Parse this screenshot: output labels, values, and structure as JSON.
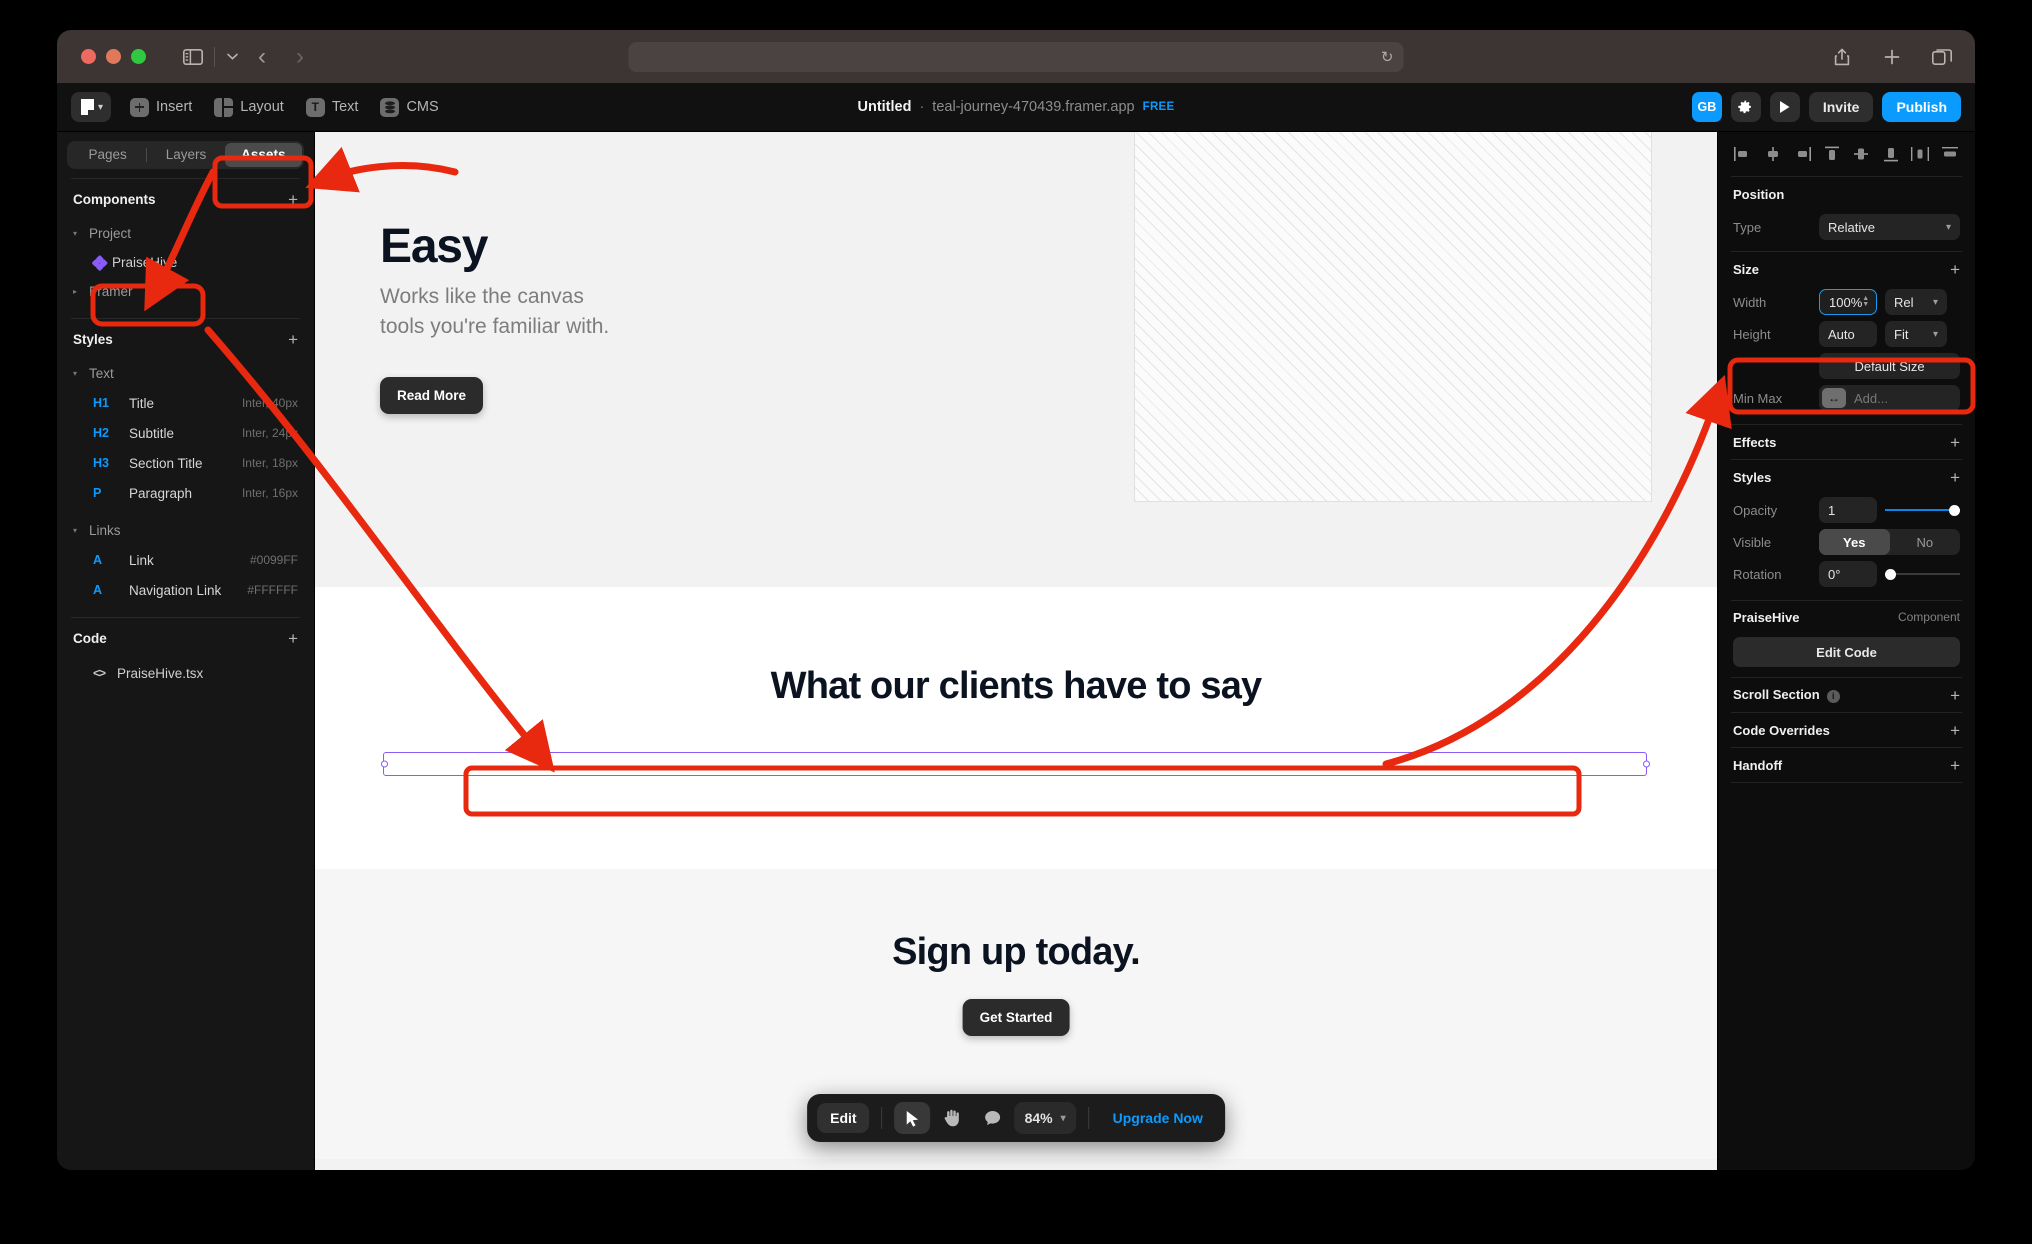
{
  "browser": {
    "traffic_lights": [
      "close",
      "minimize",
      "maximize"
    ],
    "sidebar_icon": "sidebar-toggle-icon",
    "back_label": "‹",
    "forward_label": "›",
    "address_value": "",
    "reload_icon": "↻",
    "share_icon": "share-icon",
    "new_tab_icon": "+",
    "tabs_icon": "tabs-icon"
  },
  "toolbar": {
    "logo_label": "framer-logo",
    "items": [
      {
        "label": "Insert",
        "icon": "plus-icon"
      },
      {
        "label": "Layout",
        "icon": "layout-icon"
      },
      {
        "label": "Text",
        "icon": "text-icon"
      },
      {
        "label": "CMS",
        "icon": "database-icon"
      }
    ],
    "title": {
      "name": "Untitled",
      "separator": "·",
      "domain": "teal-journey-470439.framer.app",
      "badge": "FREE"
    },
    "right": {
      "avatar": "GB",
      "settings_icon": "gear-icon",
      "preview_icon": "play-icon",
      "invite_label": "Invite",
      "publish_label": "Publish"
    }
  },
  "sidebar": {
    "tabs": [
      {
        "label": "Pages",
        "active": false
      },
      {
        "label": "Layers",
        "active": false
      },
      {
        "label": "Assets",
        "active": true
      }
    ],
    "components": {
      "title": "Components",
      "add_label": "+",
      "tree": [
        {
          "label": "Project",
          "type": "group",
          "expanded": true
        },
        {
          "label": "PraiseHive",
          "type": "component",
          "selected": true
        },
        {
          "label": "Framer",
          "type": "group",
          "expanded": false
        }
      ]
    },
    "styles": {
      "title": "Styles",
      "add_label": "+",
      "groups": [
        {
          "label": "Text",
          "expanded": true,
          "items": [
            {
              "tag": "H1",
              "name": "Title",
              "meta": "Inter, 40px"
            },
            {
              "tag": "H2",
              "name": "Subtitle",
              "meta": "Inter, 24px"
            },
            {
              "tag": "H3",
              "name": "Section Title",
              "meta": "Inter, 18px"
            },
            {
              "tag": "P",
              "name": "Paragraph",
              "meta": "Inter, 16px"
            }
          ]
        },
        {
          "label": "Links",
          "expanded": true,
          "items": [
            {
              "tag": "A",
              "name": "Link",
              "meta": "#0099FF"
            },
            {
              "tag": "A",
              "name": "Navigation Link",
              "meta": "#FFFFFF"
            }
          ]
        }
      ]
    },
    "code": {
      "title": "Code",
      "add_label": "+",
      "items": [
        {
          "name": "PraiseHive.tsx",
          "icon": "code-icon"
        }
      ]
    }
  },
  "canvas": {
    "hero": {
      "title": "Easy",
      "subtitle": "Works like the canvas\ntools you're familiar with.",
      "button": "Read More",
      "image_placeholder": "hatched-image-placeholder"
    },
    "clients": {
      "title": "What our clients have to say"
    },
    "signup": {
      "title": "Sign up today.",
      "button": "Get Started"
    },
    "bottom_bar": {
      "edit_label": "Edit",
      "cursor_icon": "cursor-icon",
      "hand_icon": "hand-icon",
      "comment_icon": "comment-icon",
      "zoom_value": "84%",
      "zoom_chevron": "⌄",
      "upgrade_label": "Upgrade Now"
    }
  },
  "inspector": {
    "align_icons": [
      "align-left-icon",
      "align-center-horizontal-icon",
      "align-right-icon",
      "align-top-icon",
      "align-center-vertical-icon",
      "align-bottom-icon",
      "distribute-horizontal-icon",
      "distribute-vertical-icon"
    ],
    "position": {
      "title": "Position",
      "type_label": "Type",
      "type_value": "Relative"
    },
    "size": {
      "title": "Size",
      "add_label": "+",
      "width_label": "Width",
      "width_value": "100%",
      "width_unit": "Rel",
      "height_label": "Height",
      "height_value": "Auto",
      "height_unit": "Fit",
      "default_size_label": "Default Size",
      "minmax_label": "Min Max",
      "minmax_placeholder": "Add...",
      "minmax_icon": "arrows-horizontal-icon"
    },
    "effects": {
      "title": "Effects",
      "add_label": "+"
    },
    "styles": {
      "title": "Styles",
      "add_label": "+",
      "opacity_label": "Opacity",
      "opacity_value": "1",
      "visible_label": "Visible",
      "visible_yes": "Yes",
      "visible_no": "No",
      "rotation_label": "Rotation",
      "rotation_value": "0°"
    },
    "component": {
      "name": "PraiseHive",
      "kind": "Component",
      "edit_code_label": "Edit Code"
    },
    "sections": [
      {
        "title": "Scroll Section",
        "add_label": "+",
        "has_info": true
      },
      {
        "title": "Code Overrides",
        "add_label": "+",
        "has_info": false
      },
      {
        "title": "Handoff",
        "add_label": "+",
        "has_info": false
      }
    ]
  },
  "annotations": {
    "color": "#e8280f",
    "boxes": [
      {
        "target": "assets-tab"
      },
      {
        "target": "praisehive-component"
      },
      {
        "target": "selected-component-on-canvas"
      },
      {
        "target": "width-field"
      }
    ],
    "arrows": [
      {
        "from": "right-of-assets-tab",
        "to": "assets-tab"
      },
      {
        "from": "assets-tab",
        "to": "praisehive-component"
      },
      {
        "from": "praisehive-component",
        "to": "selected-component-on-canvas"
      },
      {
        "from": "selected-component-on-canvas",
        "to": "width-field"
      }
    ]
  }
}
